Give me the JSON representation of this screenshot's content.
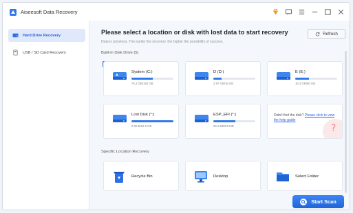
{
  "window": {
    "title": "Aiseesoft Data Recovery",
    "titlebar_icons": [
      "premium-diamond-icon",
      "feedback-icon",
      "menu-icon",
      "minimize-icon",
      "maximize-icon",
      "close-icon"
    ]
  },
  "sidebar": {
    "items": [
      {
        "label": "Hard Drive Recovery",
        "icon": "hard-drive-icon",
        "active": true
      },
      {
        "label": "USB / SD Card Recovery",
        "icon": "usb-icon",
        "active": false
      }
    ]
  },
  "main": {
    "title": "Please select a location or disk with lost data to start recovery",
    "subtitle": "Data is priceless. The earlier the recovery, the higher the possibility of success.",
    "refresh_label": "Refresh",
    "builtin_label": "Built-in Disk Drive (5)",
    "drives": [
      {
        "name": "System (C:)",
        "size": "75.2 GB/150 GB",
        "fill": 0.5
      },
      {
        "name": "D (D:)",
        "size": "2.97 GB/16 GB",
        "fill": 0.19
      },
      {
        "name": "E (E:)",
        "size": "16.3 GB/50 GB",
        "fill": 0.33
      },
      {
        "name": "Lost Disk (*:)",
        "size": "0.00 B/16.0 GB",
        "fill": 1.0
      },
      {
        "name": "ESP_EFI (*:)",
        "size": "26.2 MB/50 MB",
        "fill": 0.52
      }
    ],
    "help": {
      "text": "Didn't find the disk?",
      "link": "Please click to view the help guide"
    },
    "specific_label": "Specific Location Recovery",
    "locations": [
      {
        "label": "Recycle Bin",
        "icon": "recycle-bin-icon"
      },
      {
        "label": "Desktop",
        "icon": "desktop-icon"
      },
      {
        "label": "Select Folder",
        "icon": "folder-icon"
      }
    ],
    "scan_label": "Start Scan"
  },
  "colors": {
    "accent": "#2f78ea",
    "active_bg": "#dfe9fb"
  }
}
